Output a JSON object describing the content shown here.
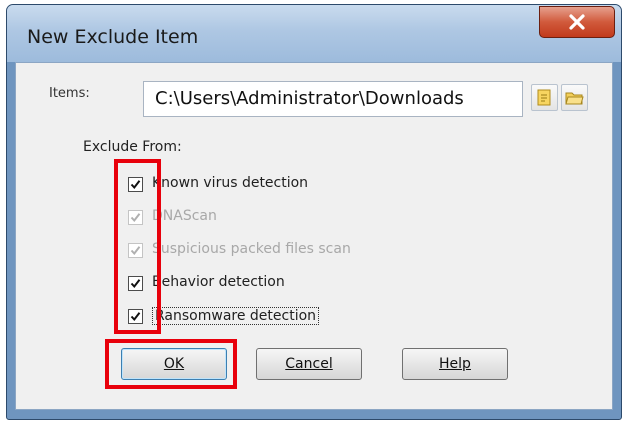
{
  "window": {
    "title": "New Exclude Item",
    "close_label": "X"
  },
  "items": {
    "label": "Items:",
    "path": "C:\\Users\\Administrator\\Downloads",
    "new_icon": "new-file-icon",
    "browse_icon": "open-folder-icon"
  },
  "exclude": {
    "label": "Exclude From:",
    "options": [
      {
        "label": "Known virus detection",
        "checked": true,
        "enabled": true
      },
      {
        "label": "DNAScan",
        "checked": true,
        "enabled": false
      },
      {
        "label": "Suspicious packed files scan",
        "checked": true,
        "enabled": false
      },
      {
        "label": "Behavior detection",
        "checked": true,
        "enabled": true
      },
      {
        "label": "Ransomware detection",
        "checked": true,
        "enabled": true
      }
    ]
  },
  "buttons": {
    "ok": "OK",
    "cancel": "Cancel",
    "help": "Help"
  },
  "colors": {
    "highlight": "#e8000b",
    "titlebar": "#aec7e3",
    "close": "#c23a1b"
  }
}
